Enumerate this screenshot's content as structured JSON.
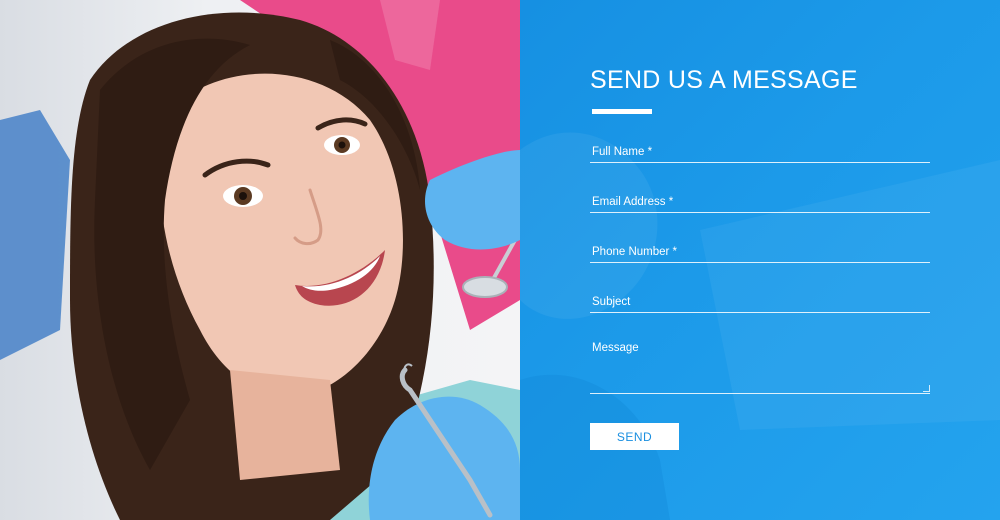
{
  "form": {
    "title": "SEND US A MESSAGE",
    "fields": {
      "full_name": {
        "placeholder": "Full Name *",
        "value": ""
      },
      "email": {
        "placeholder": "Email Address *",
        "value": ""
      },
      "phone": {
        "placeholder": "Phone Number *",
        "value": ""
      },
      "subject": {
        "placeholder": "Subject",
        "value": ""
      },
      "message": {
        "placeholder": "Message",
        "value": ""
      }
    },
    "send_label": "SEND"
  },
  "colors": {
    "panel_blue": "#1c9ae9",
    "accent_pink": "#e94b8a",
    "glove_blue": "#5db4f0",
    "button_text": "#1a8fe0"
  },
  "photo": {
    "subject": "smiling woman in dental chair with dentist tools"
  }
}
